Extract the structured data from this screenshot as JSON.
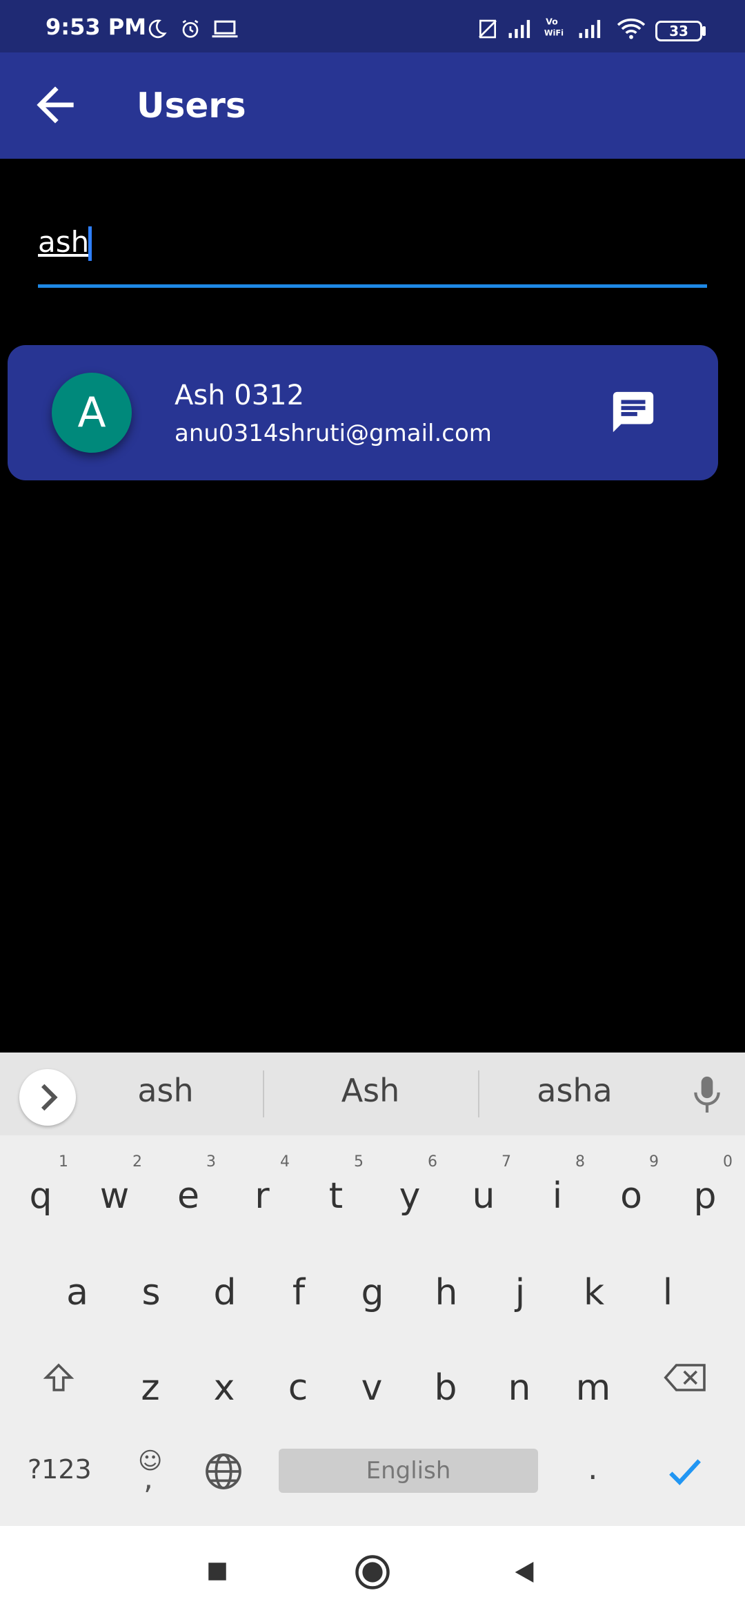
{
  "status_bar": {
    "time": "9:53 PM",
    "battery": "33",
    "icons": [
      "moon-icon",
      "alarm-icon",
      "laptop-icon",
      "no-sim-icon",
      "signal-icon",
      "vowifi-icon",
      "signal-icon-2",
      "wifi-icon",
      "battery-icon"
    ]
  },
  "app_bar": {
    "title": "Users"
  },
  "search": {
    "value": "ash"
  },
  "users": [
    {
      "initial": "A",
      "name": "Ash 0312",
      "email": "anu0314shruti@gmail.com"
    }
  ],
  "keyboard": {
    "suggestions": [
      "ash",
      "Ash",
      "asha"
    ],
    "row1": [
      "q",
      "w",
      "e",
      "r",
      "t",
      "y",
      "u",
      "i",
      "o",
      "p"
    ],
    "row1_hints": [
      "1",
      "2",
      "3",
      "4",
      "5",
      "6",
      "7",
      "8",
      "9",
      "0"
    ],
    "row2": [
      "a",
      "s",
      "d",
      "f",
      "g",
      "h",
      "j",
      "k",
      "l"
    ],
    "row3": [
      "z",
      "x",
      "c",
      "v",
      "b",
      "n",
      "m"
    ],
    "symbols_label": "?123",
    "comma_label": ",",
    "space_label": "English",
    "period_label": "."
  },
  "colors": {
    "status_bar_bg": "#1f2a74",
    "app_bar_bg": "#283593",
    "avatar_bg": "#00897b",
    "accent_blue": "#1e88e5"
  }
}
